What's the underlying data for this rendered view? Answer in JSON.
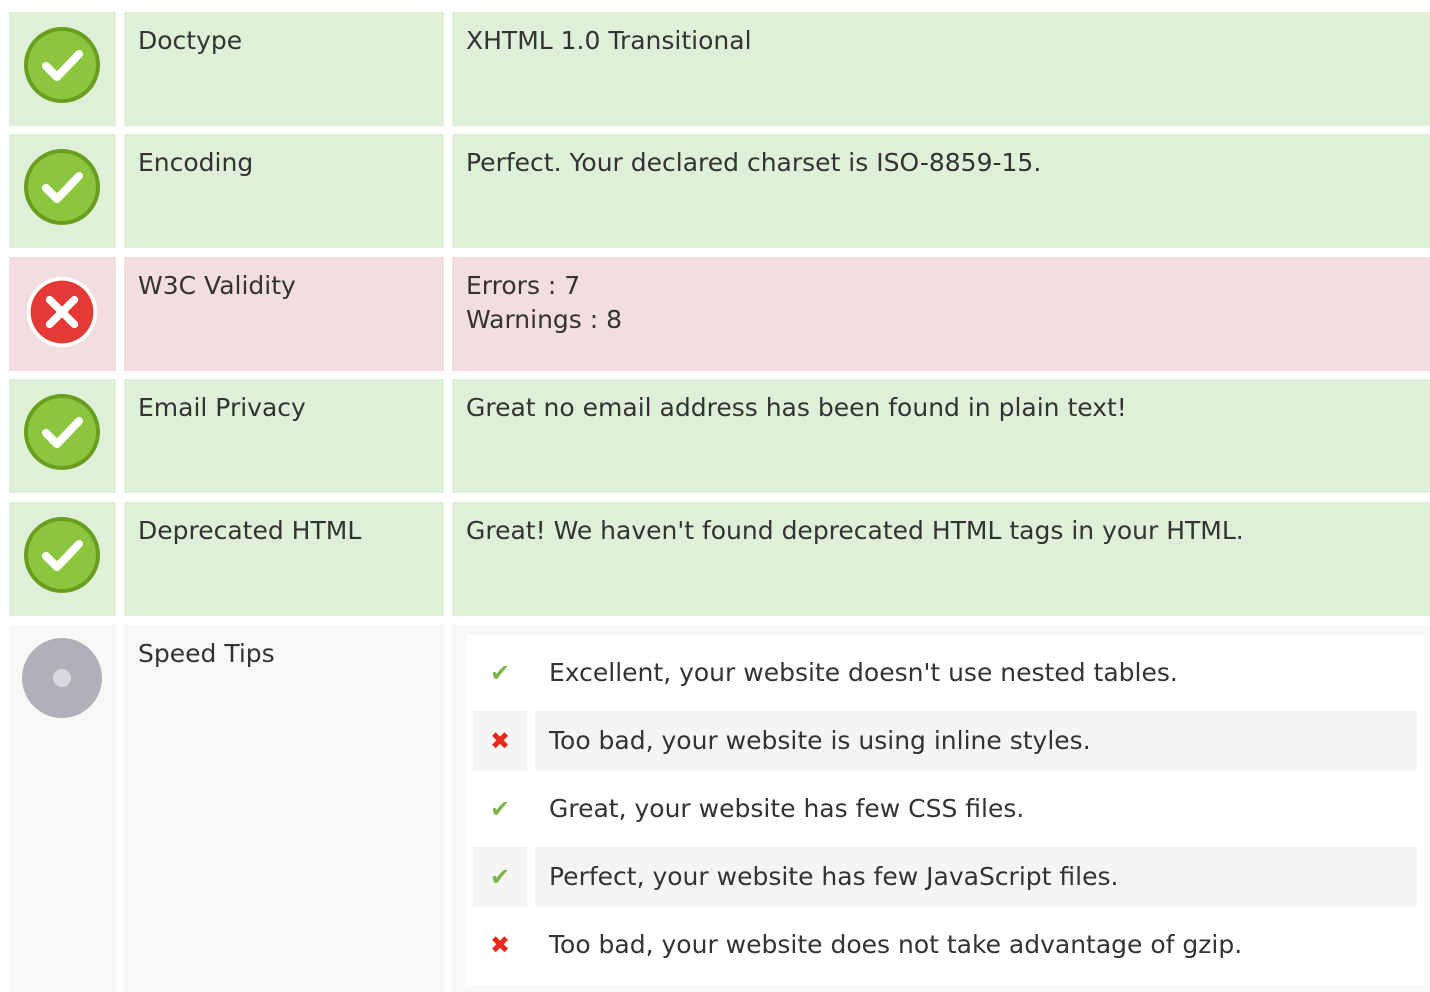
{
  "colors": {
    "ok_row": "#dff0d8",
    "bad_row": "#f2dede",
    "neutral_row": "#f8f8f8",
    "ok_icon": "#8cc63f",
    "bad_icon": "#e53935",
    "neutral_icon": "#b0b0b8"
  },
  "rows": [
    {
      "status": "ok",
      "icon": "check-circle-icon",
      "label": "Doctype",
      "values": [
        "XHTML 1.0 Transitional"
      ]
    },
    {
      "status": "ok",
      "icon": "check-circle-icon",
      "label": "Encoding",
      "values": [
        "Perfect. Your declared charset is ISO-8859-15."
      ]
    },
    {
      "status": "bad",
      "icon": "error-circle-icon",
      "label": "W3C Validity",
      "values": [
        "Errors : 7",
        "Warnings : 8"
      ]
    },
    {
      "status": "ok",
      "icon": "check-circle-icon",
      "label": "Email Privacy",
      "values": [
        "Great no email address has been found in plain text!"
      ]
    },
    {
      "status": "ok",
      "icon": "check-circle-icon",
      "label": "Deprecated HTML",
      "values": [
        "Great! We haven't found deprecated HTML tags in your HTML."
      ]
    }
  ],
  "speed_tips": {
    "label": "Speed Tips",
    "icon": "neutral-circle-icon",
    "items": [
      {
        "status": "ok",
        "icon": "checkmark-icon",
        "text": "Excellent, your website doesn't use nested tables."
      },
      {
        "status": "bad",
        "icon": "cross-icon",
        "text": "Too bad, your website is using inline styles."
      },
      {
        "status": "ok",
        "icon": "checkmark-icon",
        "text": "Great, your website has few CSS files."
      },
      {
        "status": "ok",
        "icon": "checkmark-icon",
        "text": "Perfect, your website has few JavaScript files."
      },
      {
        "status": "bad",
        "icon": "cross-icon",
        "text": "Too bad, your website does not take advantage of gzip."
      }
    ]
  }
}
